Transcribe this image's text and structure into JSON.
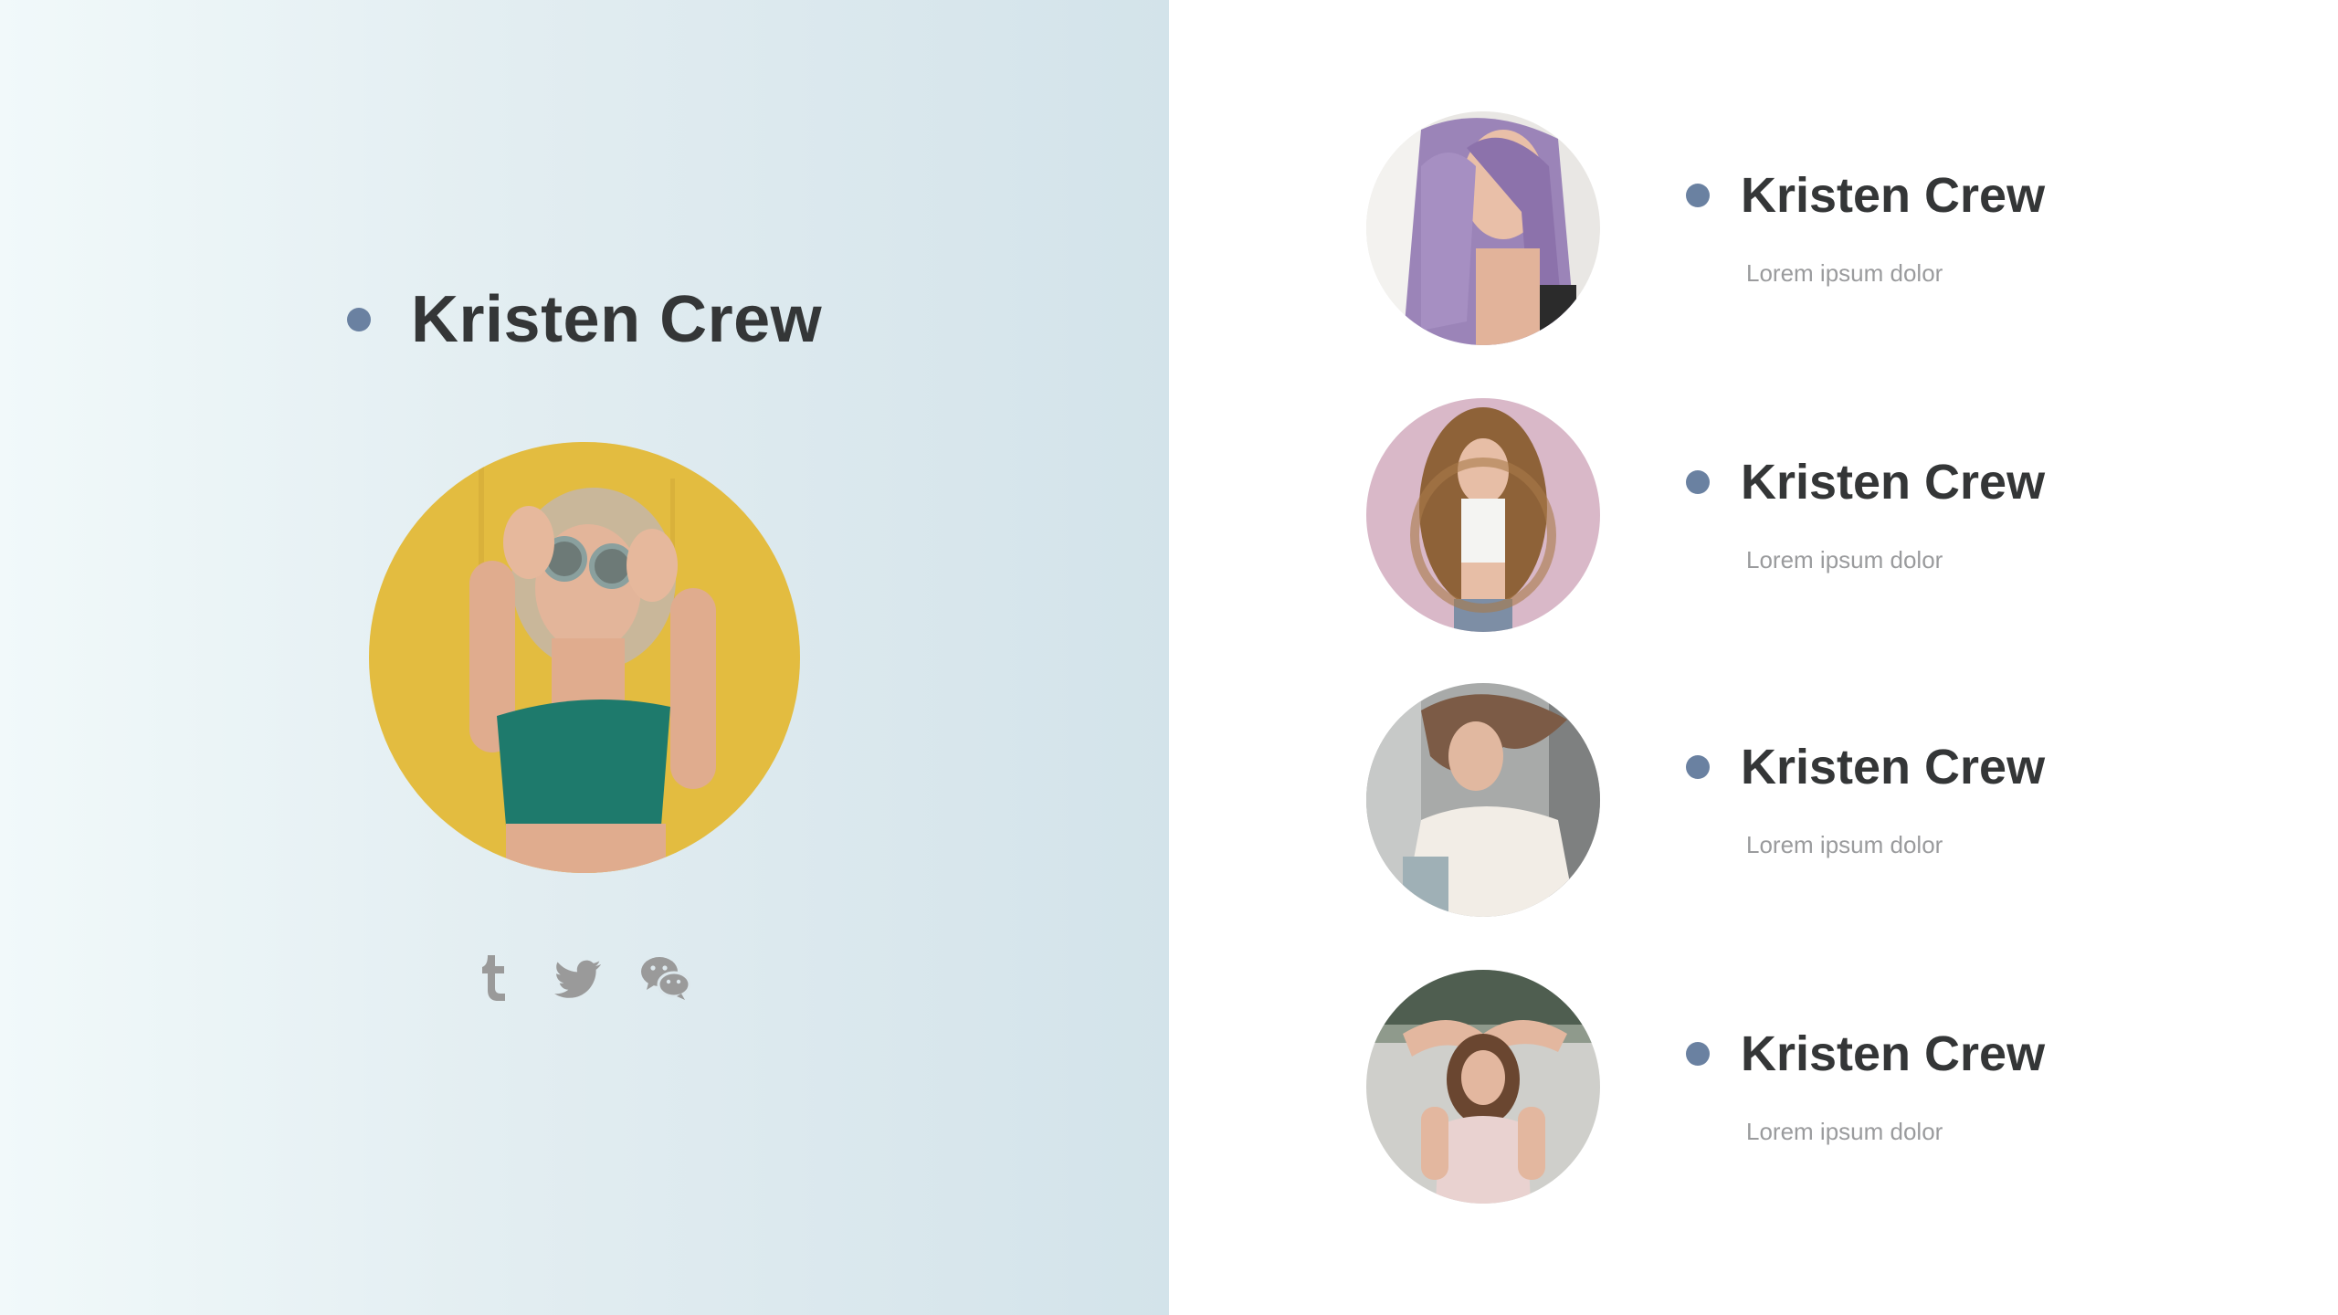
{
  "featured": {
    "name": "Kristen Crew",
    "photo_alt": "Woman with round sunglasses against yellow wall"
  },
  "social": [
    {
      "icon": "tumblr-icon"
    },
    {
      "icon": "twitter-icon"
    },
    {
      "icon": "wechat-icon"
    }
  ],
  "members": [
    {
      "name": "Kristen Crew",
      "description": "Lorem ipsum dolor",
      "photo": "purple-hair"
    },
    {
      "name": "Kristen Crew",
      "description": "Lorem ipsum dolor",
      "photo": "curly-hair-pink-wall"
    },
    {
      "name": "Kristen Crew",
      "description": "Lorem ipsum dolor",
      "photo": "windblown-hair"
    },
    {
      "name": "Kristen Crew",
      "description": "Lorem ipsum dolor",
      "photo": "hands-on-head"
    }
  ],
  "colors": {
    "accent_bullet": "#6a81a1",
    "name_text": "#343637",
    "desc_text": "#9a9b9d",
    "icon_gray": "#9a9a9a",
    "panel_gradient_start": "#f1f9fa",
    "panel_gradient_end": "#d3e3ea"
  }
}
